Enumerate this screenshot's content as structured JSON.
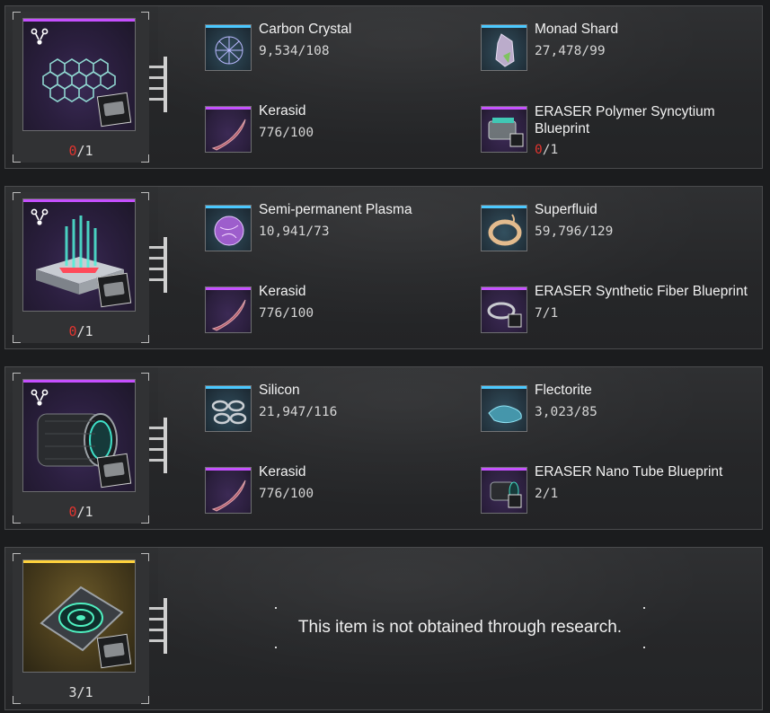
{
  "panels": [
    {
      "item": {
        "theme": "purple",
        "icon": "hex-mesh-icon",
        "has": "0",
        "sep": "/",
        "need": "1",
        "has_color": "#e2342f",
        "research_icon": "research-tree-icon",
        "blueprint_badge": "blueprint-badge-icon"
      },
      "materials": [
        {
          "name": "Carbon Crystal",
          "count": "9,534/108",
          "theme": "blue",
          "icon": "carbon-crystal-icon"
        },
        {
          "name": "Monad Shard",
          "count": "27,478/99",
          "theme": "blue",
          "icon": "monad-shard-icon"
        },
        {
          "name": "Kerasid",
          "count": "776/100",
          "theme": "violet",
          "icon": "kerasid-horn-icon"
        },
        {
          "name": "ERASER Polymer Syncytium Blueprint",
          "has": "0",
          "sep": "/",
          "need": "1",
          "theme": "violet",
          "icon": "polymer-syncytium-blueprint-icon"
        }
      ]
    },
    {
      "item": {
        "theme": "purple",
        "icon": "plasma-emitter-icon",
        "has": "0",
        "sep": "/",
        "need": "1",
        "has_color": "#e2342f",
        "research_icon": "research-tree-icon",
        "blueprint_badge": "blueprint-badge-icon"
      },
      "materials": [
        {
          "name": "Semi-permanent Plasma",
          "count": "10,941/73",
          "theme": "blue",
          "icon": "plasma-orb-icon"
        },
        {
          "name": "Superfluid",
          "count": "59,796/129",
          "theme": "blue",
          "icon": "superfluid-ring-icon"
        },
        {
          "name": "Kerasid",
          "count": "776/100",
          "theme": "violet",
          "icon": "kerasid-horn-icon"
        },
        {
          "name": "ERASER Synthetic Fiber Blueprint",
          "count": "7/1",
          "theme": "violet",
          "icon": "synthetic-fiber-blueprint-icon"
        }
      ]
    },
    {
      "item": {
        "theme": "purple",
        "icon": "nano-tube-cylinder-icon",
        "has": "0",
        "sep": "/",
        "need": "1",
        "has_color": "#e2342f",
        "research_icon": "research-tree-icon",
        "blueprint_badge": "blueprint-badge-icon"
      },
      "materials": [
        {
          "name": "Silicon",
          "count": "21,947/116",
          "theme": "blue",
          "icon": "silicon-rings-icon"
        },
        {
          "name": "Flectorite",
          "count": "3,023/85",
          "theme": "blue",
          "icon": "flectorite-icon"
        },
        {
          "name": "Kerasid",
          "count": "776/100",
          "theme": "violet",
          "icon": "kerasid-horn-icon"
        },
        {
          "name": "ERASER Nano Tube Blueprint",
          "count": "2/1",
          "theme": "violet",
          "icon": "nano-tube-blueprint-icon"
        }
      ]
    },
    {
      "item": {
        "theme": "gold",
        "icon": "device-module-icon",
        "count": "3/1",
        "blueprint_badge": "blueprint-badge-icon"
      },
      "notice": "This item is not obtained through research."
    }
  ],
  "colors": {
    "purple_accent": "#c54fff",
    "blue_accent": "#46c7ff",
    "gold_accent": "#ffd23c",
    "insufficient": "#e2342f"
  }
}
